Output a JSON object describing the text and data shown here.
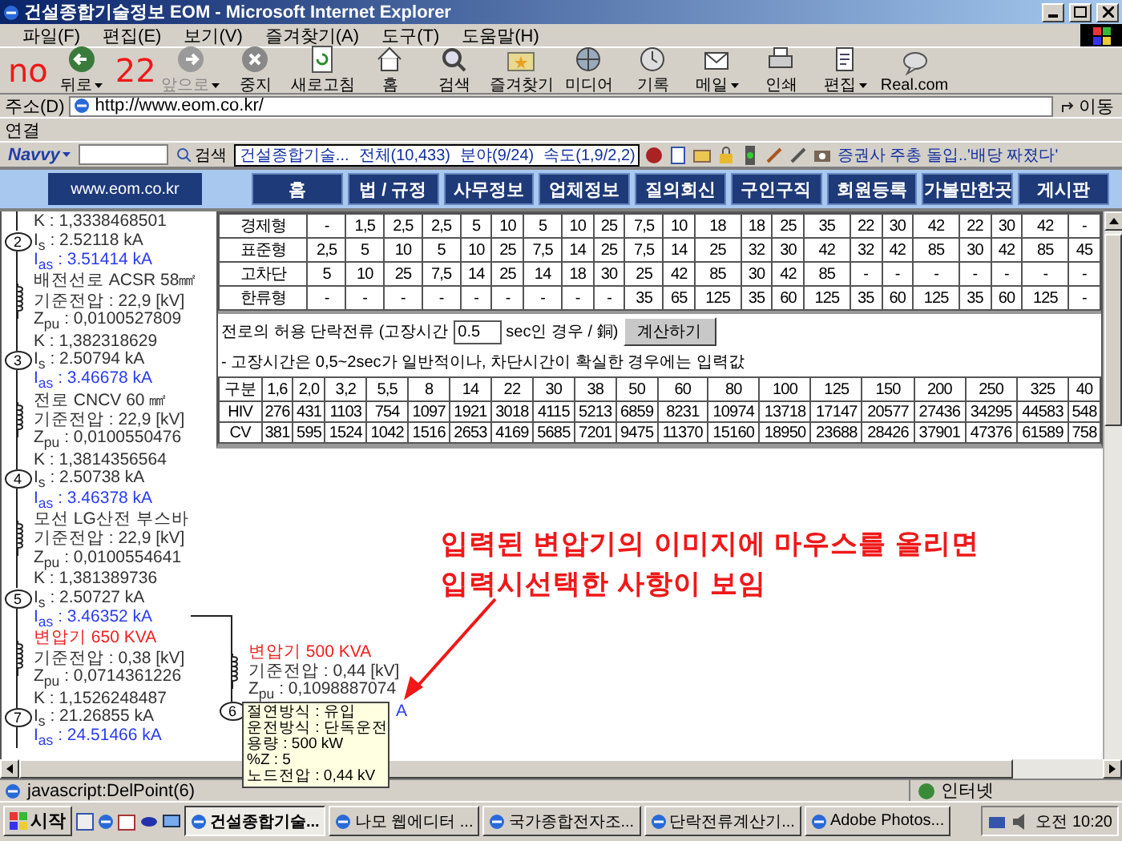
{
  "window": {
    "title": "건설종합기술정보 EOM - Microsoft Internet Explorer"
  },
  "menu": [
    "파일(F)",
    "편집(E)",
    "보기(V)",
    "즐겨찾기(A)",
    "도구(T)",
    "도움말(H)"
  ],
  "handwritten_marks": [
    "no",
    "22"
  ],
  "toolbar": [
    {
      "label": "뒤로",
      "disabled": false,
      "dropdown": true
    },
    {
      "label": "앞으로",
      "disabled": true,
      "dropdown": true
    },
    {
      "label": "중지",
      "disabled": false,
      "dropdown": false
    },
    {
      "label": "새로고침",
      "disabled": false,
      "dropdown": false
    },
    {
      "label": "홈",
      "disabled": false,
      "dropdown": false
    },
    {
      "label": "검색",
      "disabled": false,
      "dropdown": false
    },
    {
      "label": "즐겨찾기",
      "disabled": false,
      "dropdown": false
    },
    {
      "label": "미디어",
      "disabled": false,
      "dropdown": false
    },
    {
      "label": "기록",
      "disabled": false,
      "dropdown": false
    },
    {
      "label": "메일",
      "disabled": false,
      "dropdown": true
    },
    {
      "label": "인쇄",
      "disabled": false,
      "dropdown": false
    },
    {
      "label": "편집",
      "disabled": false,
      "dropdown": true
    },
    {
      "label": "Real.com",
      "disabled": false,
      "dropdown": false
    }
  ],
  "address": {
    "label": "주소(D)",
    "url": "http://www.eom.co.kr/",
    "go": "이동"
  },
  "links_bar": {
    "label": "연결"
  },
  "navvy": {
    "brand": "Navvy",
    "search_button": "검색",
    "site": "건설종합기술...",
    "total": "전체(10,433)",
    "field": "분야(9/24)",
    "speed": "속도(1,9/2,2)",
    "headline": "증권사 주총 돌입..'배당 짜졌다'"
  },
  "site": {
    "logo_url": "www.eom.co.kr",
    "nav": [
      "홈",
      "법 / 규정",
      "사무정보",
      "업체정보",
      "질의회신",
      "구인구직",
      "회원등록",
      "가볼만한곳",
      "게시판"
    ]
  },
  "diagram": {
    "top_line": "K : 1,3338468501",
    "nodes": [
      {
        "number": "2",
        "lines": [
          {
            "kind": "is",
            "text": "I$_{s}$ : 2.52118 kA"
          },
          {
            "kind": "ias",
            "text": "I$_{as}$ : 3.51414 kA"
          },
          {
            "kind": "element",
            "text": "배전선로 ACSR 58㎟"
          },
          {
            "kind": "voltage",
            "text": "기준전압 : 22,9 [kV]"
          },
          {
            "kind": "impedance",
            "text": "Z$_{pu}$ : 0,0100527809"
          },
          {
            "kind": "factor",
            "text": "K : 1,382318629"
          }
        ]
      },
      {
        "number": "3",
        "lines": [
          {
            "kind": "is",
            "text": "I$_{s}$ : 2.50794 kA"
          },
          {
            "kind": "ias",
            "text": "I$_{as}$ : 3.46678 kA"
          },
          {
            "kind": "element",
            "text": "전로 CNCV 60 ㎟"
          },
          {
            "kind": "voltage",
            "text": "기준전압 : 22,9 [kV]"
          },
          {
            "kind": "impedance",
            "text": "Z$_{pu}$ : 0,0100550476"
          },
          {
            "kind": "factor",
            "text": "K : 1,3814356564"
          }
        ]
      },
      {
        "number": "4",
        "lines": [
          {
            "kind": "is",
            "text": "I$_{s}$ : 2.50738 kA"
          },
          {
            "kind": "ias",
            "text": "I$_{as}$ : 3.46378 kA"
          },
          {
            "kind": "element",
            "text": "모선 LG산전 부스바"
          },
          {
            "kind": "voltage",
            "text": "기준전압 : 22,9 [kV]"
          },
          {
            "kind": "impedance",
            "text": "Z$_{pu}$ : 0,0100554641"
          },
          {
            "kind": "factor",
            "text": "K : 1,381389736"
          }
        ]
      },
      {
        "number": "5",
        "lines": [
          {
            "kind": "is",
            "text": "I$_{s}$ : 2.50727 kA"
          },
          {
            "kind": "ias",
            "text": "I$_{as}$ : 3.46352 kA"
          },
          {
            "kind": "transformer",
            "text": "변압기 650 KVA"
          },
          {
            "kind": "voltage",
            "text": "기준전압 : 0,38 [kV]"
          },
          {
            "kind": "impedance",
            "text": "Z$_{pu}$ : 0,0714361226"
          },
          {
            "kind": "factor",
            "text": "K : 1,1526248487"
          }
        ]
      },
      {
        "number": "7",
        "lines": [
          {
            "kind": "is",
            "text": "I$_{s}$ : 21.26855 kA"
          },
          {
            "kind": "ias",
            "text": "I$_{as}$ : 24.51466 kA"
          }
        ]
      }
    ],
    "branch": {
      "lines": [
        {
          "kind": "transformer",
          "text": "변압기 500 KVA"
        },
        {
          "kind": "voltage",
          "text": "기준전압 : 0,44 [kV]"
        },
        {
          "kind": "impedance",
          "text": "Z$_{pu}$ : 0,1098887074"
        }
      ],
      "node_number": "6",
      "fragment": "A"
    }
  },
  "breaker_table": {
    "rows": [
      {
        "label": "경제형",
        "values": [
          "-",
          "1,5",
          "2,5",
          "2,5",
          "5",
          "10",
          "5",
          "10",
          "25",
          "7,5",
          "10",
          "18",
          "18",
          "25",
          "35",
          "22",
          "30",
          "42",
          "22",
          "30",
          "42",
          "-"
        ]
      },
      {
        "label": "표준형",
        "values": [
          "2,5",
          "5",
          "10",
          "5",
          "10",
          "25",
          "7,5",
          "14",
          "25",
          "7,5",
          "14",
          "25",
          "32",
          "30",
          "42",
          "32",
          "42",
          "85",
          "30",
          "42",
          "85",
          "45"
        ]
      },
      {
        "label": "고차단",
        "values": [
          "5",
          "10",
          "25",
          "7,5",
          "14",
          "25",
          "14",
          "18",
          "30",
          "25",
          "42",
          "85",
          "30",
          "42",
          "85",
          "-",
          "-",
          "-",
          "-",
          "-",
          "-",
          "-"
        ]
      },
      {
        "label": "한류형",
        "values": [
          "-",
          "-",
          "-",
          "-",
          "-",
          "-",
          "-",
          "-",
          "-",
          "35",
          "65",
          "125",
          "35",
          "60",
          "125",
          "35",
          "60",
          "125",
          "35",
          "60",
          "125",
          "-"
        ]
      }
    ]
  },
  "cable_table": {
    "prompt": "전로의 허용 단락전류 (고장시간",
    "time": "0.5",
    "unit": "sec인 경우 / 銅)",
    "button": "계산하기",
    "note": "- 고장시간은 0,5~2sec가 일반적이나, 차단시간이 확실한 경우에는 입력값",
    "header": {
      "label": "구분",
      "values": [
        "1,6",
        "2,0",
        "3,2",
        "5,5",
        "8",
        "14",
        "22",
        "30",
        "38",
        "50",
        "60",
        "80",
        "100",
        "125",
        "150",
        "200",
        "250",
        "325",
        "40"
      ]
    },
    "rows": [
      {
        "label": "HIV",
        "values": [
          "276",
          "431",
          "1103",
          "754",
          "1097",
          "1921",
          "3018",
          "4115",
          "5213",
          "6859",
          "8231",
          "10974",
          "13718",
          "17147",
          "20577",
          "27436",
          "34295",
          "44583",
          "548"
        ]
      },
      {
        "label": "CV",
        "values": [
          "381",
          "595",
          "1524",
          "1042",
          "1516",
          "2653",
          "4169",
          "5685",
          "7201",
          "9475",
          "11370",
          "15160",
          "18950",
          "23688",
          "28426",
          "37901",
          "47376",
          "61589",
          "758"
        ]
      }
    ]
  },
  "annotation": {
    "lines": [
      "입력된 변압기의 이미지에 마우스를 올리면",
      "입력시선택한 사항이 보임"
    ]
  },
  "tooltip": [
    "절연방식 : 유입",
    "운전방식 : 단독운전",
    "용량 : 500 kW",
    "%Z  : 5",
    "노드전압 : 0,44 kV"
  ],
  "status": {
    "text": "javascript:DelPoint(6)",
    "zone": "인터넷"
  },
  "taskbar": {
    "start": "시작",
    "tasks": [
      {
        "label": "건설종합기술...",
        "selected": true
      },
      {
        "label": "나모 웹에디터 ...",
        "selected": false
      },
      {
        "label": "국가종합전자조...",
        "selected": false
      },
      {
        "label": "단락전류계산기...",
        "selected": false
      },
      {
        "label": "Adobe Photos...",
        "selected": false
      }
    ],
    "clock": "오전 10:20"
  }
}
